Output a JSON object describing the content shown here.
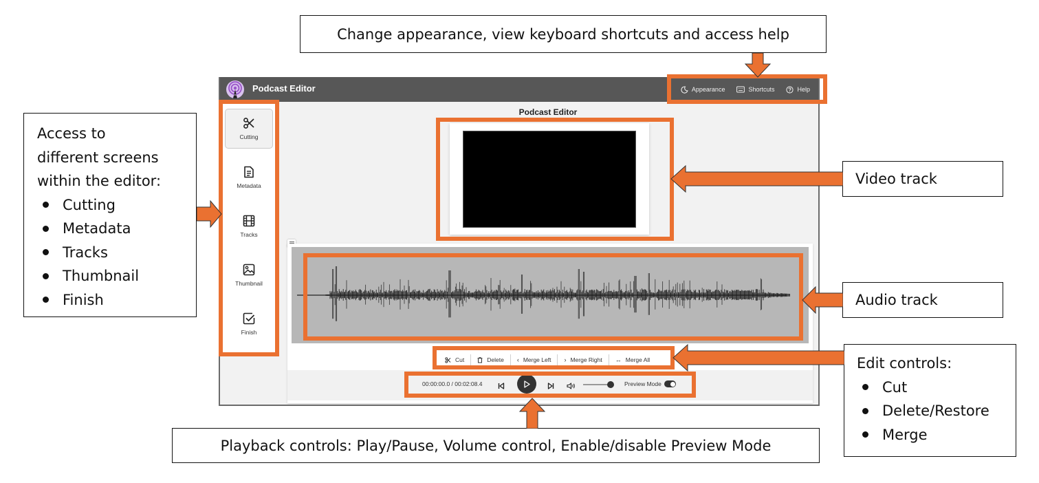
{
  "app": {
    "title": "Podcast Editor",
    "main_title": "Podcast Editor",
    "accent_color": "#ea7131",
    "top_actions": [
      {
        "label": "Appearance",
        "icon": "moon-icon"
      },
      {
        "label": "Shortcuts",
        "icon": "keyboard-icon"
      },
      {
        "label": "Help",
        "icon": "help-circle-icon"
      }
    ],
    "sidebar": {
      "items": [
        {
          "label": "Cutting",
          "icon": "scissors-icon",
          "active": true
        },
        {
          "label": "Metadata",
          "icon": "document-icon",
          "active": false
        },
        {
          "label": "Tracks",
          "icon": "film-icon",
          "active": false
        },
        {
          "label": "Thumbnail",
          "icon": "image-icon",
          "active": false
        },
        {
          "label": "Finish",
          "icon": "checkbox-icon",
          "active": false
        }
      ]
    },
    "edit_controls": [
      {
        "label": "Cut",
        "icon": "scissors-icon"
      },
      {
        "label": "Delete",
        "icon": "trash-icon"
      },
      {
        "label": "Merge Left",
        "icon": "chevron-left-icon"
      },
      {
        "label": "Merge Right",
        "icon": "chevron-right-icon"
      },
      {
        "label": "Merge All",
        "icon": "arrows-horizontal-icon"
      }
    ],
    "playback": {
      "current_time": "00:00:00.0",
      "duration": "00:02:08.4",
      "time_display": "00:00:00.0 / 00:02:08.4",
      "playing": false,
      "volume_fraction": 1.0,
      "preview_mode_label": "Preview Mode",
      "preview_mode_enabled": true
    }
  },
  "callouts": {
    "top": "Change appearance, view keyboard shortcuts and access help",
    "left": {
      "heading_lines": [
        "Access to",
        "different screens",
        "within the editor:"
      ],
      "items": [
        "Cutting",
        "Metadata",
        "Tracks",
        "Thumbnail",
        "Finish"
      ]
    },
    "video": "Video track",
    "audio": "Audio track",
    "edit": {
      "heading": "Edit controls:",
      "items": [
        "Cut",
        "Delete/Restore",
        "Merge"
      ]
    },
    "playback": "Playback controls:  Play/Pause, Volume control, Enable/disable Preview Mode"
  }
}
